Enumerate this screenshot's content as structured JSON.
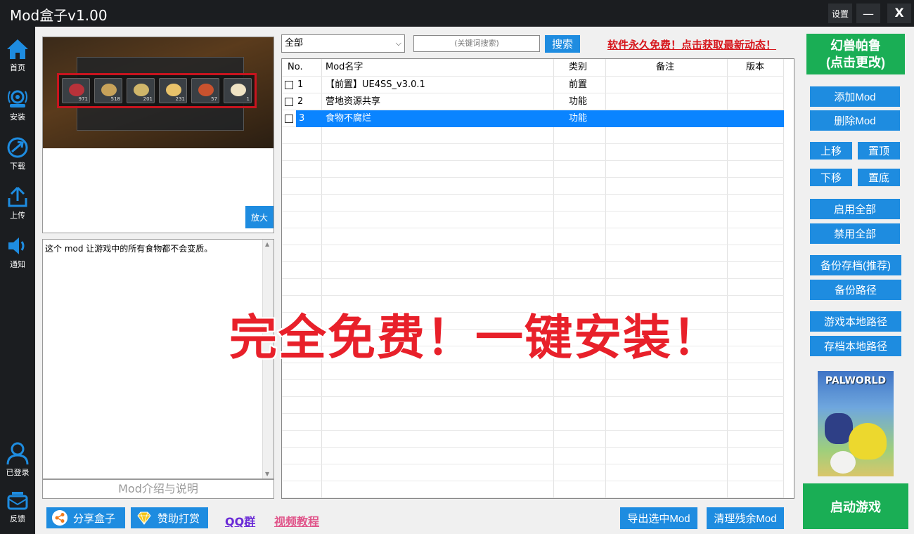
{
  "window": {
    "title": "Mod盒子v1.00",
    "settings_label": "设置",
    "minimize_label": "—",
    "close_label": "X"
  },
  "sidebar": {
    "items": [
      {
        "label": "首页",
        "icon": "home-icon"
      },
      {
        "label": "安装",
        "icon": "install-icon"
      },
      {
        "label": "下载",
        "icon": "download-icon"
      },
      {
        "label": "上传",
        "icon": "upload-icon"
      },
      {
        "label": "通知",
        "icon": "speaker-icon"
      }
    ],
    "bottom_items": [
      {
        "label": "已登录",
        "icon": "user-icon"
      },
      {
        "label": "反馈",
        "icon": "feedback-icon"
      }
    ]
  },
  "preview": {
    "zoom_label": "放大",
    "slot_counts": [
      "971",
      "518",
      "201",
      "231",
      "57",
      "1"
    ],
    "slot_tops": [
      "104.2",
      "103.6",
      "100.5",
      "115.0",
      "26.5",
      "1.0"
    ]
  },
  "description": {
    "text": "这个 mod 让游戏中的所有食物都不会变质。",
    "caption": "Mod介绍与说明"
  },
  "filter": {
    "selected": "全部",
    "arrow": "⌵"
  },
  "search": {
    "placeholder": "(关键词搜索)",
    "button_label": "搜索"
  },
  "promo_text": "软件永久免费！点击获取最新动态！",
  "table": {
    "headers": {
      "no": "No.",
      "name": "Mod名字",
      "type": "类别",
      "note": "备注",
      "version": "版本"
    },
    "rows": [
      {
        "no": "1",
        "name": "【前置】UE4SS_v3.0.1",
        "type": "前置",
        "note": "",
        "version": "",
        "selected": false
      },
      {
        "no": "2",
        "name": "营地资源共享",
        "type": "功能",
        "note": "",
        "version": "",
        "selected": false
      },
      {
        "no": "3",
        "name": "食物不腐烂",
        "type": "功能",
        "note": "",
        "version": "",
        "selected": true
      }
    ]
  },
  "overlay_text": "完全免费！一键安装！",
  "right": {
    "game_line1": "幻兽帕鲁",
    "game_line2": "(点击更改)",
    "add_mod": "添加Mod",
    "delete_mod": "删除Mod",
    "move_up": "上移",
    "move_top": "置顶",
    "move_down": "下移",
    "move_bottom": "置底",
    "enable_all": "启用全部",
    "disable_all": "禁用全部",
    "backup_save": "备份存档(推荐)",
    "backup_path": "备份路径",
    "game_path": "游戏本地路径",
    "save_path": "存档本地路径",
    "palworld_logo": "PALWORLD",
    "launch": "启动游戏"
  },
  "bottom": {
    "share": "分享盒子",
    "donate": "赞助打赏",
    "qq": "QQ群",
    "video": "视频教程",
    "export": "导出选中Mod",
    "clean": "清理残余Mod"
  },
  "colors": {
    "accent_blue": "#1e8ce0",
    "green": "#1aae55",
    "dark": "#1b1d20",
    "selection": "#0a84ff",
    "promo_red": "#d6161c"
  }
}
